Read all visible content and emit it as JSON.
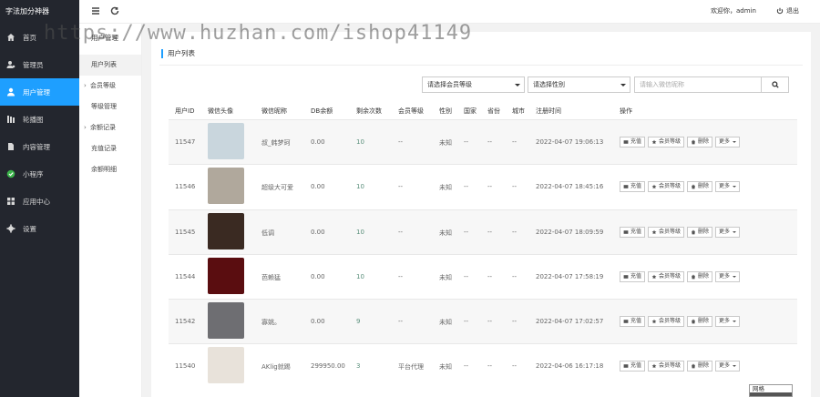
{
  "app": {
    "brand": "字法加分神器"
  },
  "sidebar": {
    "items": [
      {
        "label": "首页",
        "icon": "home-icon",
        "active": false
      },
      {
        "label": "管理员",
        "icon": "user-cog-icon",
        "active": false
      },
      {
        "label": "用户管理",
        "icon": "user-icon",
        "active": true
      },
      {
        "label": "轮播图",
        "icon": "slides-icon",
        "active": false
      },
      {
        "label": "内容管理",
        "icon": "document-icon",
        "active": false
      },
      {
        "label": "小程序",
        "icon": "check-circle-icon",
        "active": false
      },
      {
        "label": "应用中心",
        "icon": "grid-icon",
        "active": false
      },
      {
        "label": "设置",
        "icon": "gear-icon",
        "active": false
      }
    ]
  },
  "subnav": {
    "title": "用户管理",
    "items": [
      {
        "label": "用户列表",
        "type": "item",
        "selected": true
      },
      {
        "label": "会员等级",
        "type": "group"
      },
      {
        "label": "等级管理",
        "type": "item"
      },
      {
        "label": "余额记录",
        "type": "group"
      },
      {
        "label": "充值记录",
        "type": "item"
      },
      {
        "label": "余额明细",
        "type": "item"
      }
    ]
  },
  "header": {
    "welcome": "欢迎你，admin",
    "logout": "退出"
  },
  "watermark": "https://www.huzhan.com/ishop41149",
  "panel": {
    "title": "用户列表",
    "filters": {
      "level_placeholder": "请选择会员等级",
      "gender_placeholder": "请选择性别",
      "search_placeholder": "请输入微信昵称"
    },
    "columns": [
      "用户ID",
      "微信头像",
      "微信昵称",
      "DB余额",
      "剩余次数",
      "会员等级",
      "性别",
      "国家",
      "省份",
      "城市",
      "注册时间",
      "操作"
    ],
    "actions": {
      "recharge": "充值",
      "level": "会员等级",
      "delete": "删除",
      "more": "更多"
    },
    "rows": [
      {
        "id": "11547",
        "nickname": "叔_韩梦珂",
        "balance": "0.00",
        "remaining": "10",
        "level": "--",
        "gender": "未知",
        "country": "--",
        "province": "--",
        "city": "--",
        "registered": "2022-04-07 19:06:13",
        "avatar_color": "#c9d6dd"
      },
      {
        "id": "11546",
        "nickname": "超级大可爱",
        "balance": "0.00",
        "remaining": "10",
        "level": "--",
        "gender": "未知",
        "country": "--",
        "province": "--",
        "city": "--",
        "registered": "2022-04-07 18:45:16",
        "avatar_color": "#b0a89c"
      },
      {
        "id": "11545",
        "nickname": "低调",
        "balance": "0.00",
        "remaining": "10",
        "level": "--",
        "gender": "未知",
        "country": "--",
        "province": "--",
        "city": "--",
        "registered": "2022-04-07 18:09:59",
        "avatar_color": "#3a2a22"
      },
      {
        "id": "11544",
        "nickname": "芭赖猛",
        "balance": "0.00",
        "remaining": "10",
        "level": "--",
        "gender": "未知",
        "country": "--",
        "province": "--",
        "city": "--",
        "registered": "2022-04-07 17:58:19",
        "avatar_color": "#5a0d10"
      },
      {
        "id": "11542",
        "nickname": "寡姚。",
        "balance": "0.00",
        "remaining": "9",
        "level": "--",
        "gender": "未知",
        "country": "--",
        "province": "--",
        "city": "--",
        "registered": "2022-04-07 17:02:57",
        "avatar_color": "#6e6e72"
      },
      {
        "id": "11540",
        "nickname": "AKlig就踢",
        "balance": "299950.00",
        "remaining": "3",
        "level": "平台代理",
        "gender": "未知",
        "country": "--",
        "province": "--",
        "city": "--",
        "registered": "2022-04-06 16:17:18",
        "avatar_color": "#e8e2da"
      }
    ]
  },
  "popup": {
    "text": "网格"
  },
  "colors": {
    "accent": "#1e9fff",
    "sidebar_bg": "#23262e"
  }
}
